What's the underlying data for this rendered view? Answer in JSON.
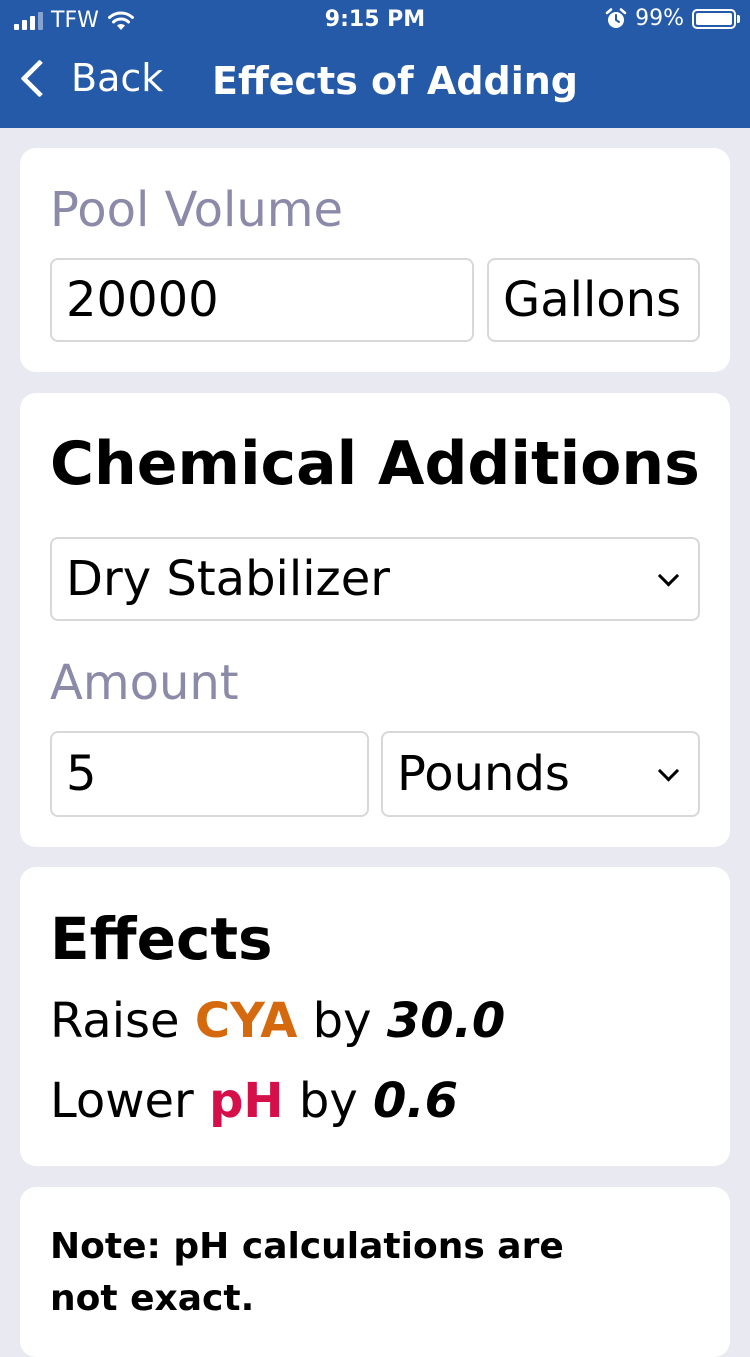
{
  "status_bar": {
    "carrier": "TFW",
    "time": "9:15 PM",
    "battery_percent": "99%",
    "battery_level": 0.99
  },
  "nav": {
    "back_label": "Back",
    "title": "Effects of Adding"
  },
  "pool_volume": {
    "label": "Pool Volume",
    "value": "20000",
    "unit": "Gallons"
  },
  "chemical_additions": {
    "heading": "Chemical Additions",
    "chemical": "Dry Stabilizer",
    "amount_label": "Amount",
    "amount_value": "5",
    "amount_unit": "Pounds"
  },
  "effects": {
    "heading": "Effects",
    "lines": [
      {
        "verb": "Raise",
        "chemical": "CYA",
        "by": "by",
        "value": "30.0",
        "color": "#d4690d"
      },
      {
        "verb": "Lower",
        "chemical": "pH",
        "by": "by",
        "value": "0.6",
        "color": "#d50f4a"
      }
    ]
  },
  "note": {
    "text": "Note: pH calculations are not exact."
  },
  "colors": {
    "header": "#255aa9",
    "background": "#e9e9f1",
    "label": "#8c8aa9"
  }
}
